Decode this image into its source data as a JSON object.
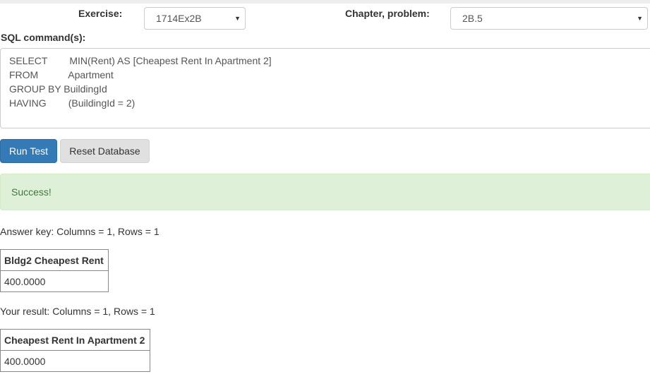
{
  "form": {
    "exercise_label": "Exercise:",
    "exercise_value": "1714Ex2B",
    "chapter_label": "Chapter, problem:",
    "chapter_value": "2B.5",
    "sql_label": "SQL command(s):"
  },
  "sql": {
    "lines": [
      "SELECT        MIN(Rent) AS [Cheapest Rent In Apartment 2]",
      "FROM           Apartment",
      "GROUP BY BuildingId",
      "HAVING        (BuildingId = 2)"
    ]
  },
  "buttons": {
    "run_test": "Run Test",
    "reset_database": "Reset Database"
  },
  "alert": {
    "message": "Success!"
  },
  "answer_key": {
    "summary": "Answer key: Columns = 1, Rows = 1",
    "header": "Bldg2 Cheapest Rent",
    "value": "400.0000"
  },
  "your_result": {
    "summary": "Your result: Columns = 1, Rows = 1",
    "header": "Cheapest Rent In Apartment 2",
    "value": "400.0000"
  },
  "colors": {
    "primary": "#337ab7",
    "success_bg": "#dff0d8",
    "success_text": "#3c763d",
    "default_button": "#e0e0e0"
  },
  "icons": {
    "dropdown": "chevron-down-icon"
  }
}
